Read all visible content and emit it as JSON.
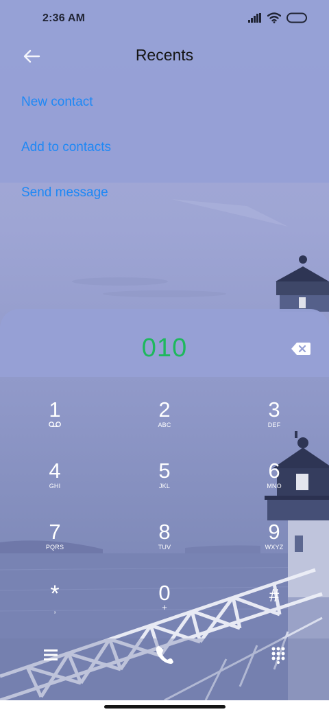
{
  "status_bar": {
    "time": "2:36 AM",
    "icons": [
      "signal-icon",
      "wifi-icon",
      "battery-icon"
    ]
  },
  "header": {
    "title": "Recents",
    "back_icon": "back-arrow-icon"
  },
  "actions": {
    "new_contact": "New contact",
    "add_to_contacts": "Add to contacts",
    "send_message": "Send message"
  },
  "dialer": {
    "number": "010",
    "backspace_icon": "backspace-icon",
    "keys": [
      {
        "digit": "1",
        "letters": "",
        "sub_icon": "voicemail-icon"
      },
      {
        "digit": "2",
        "letters": "ABC"
      },
      {
        "digit": "3",
        "letters": "DEF"
      },
      {
        "digit": "4",
        "letters": "GHI"
      },
      {
        "digit": "5",
        "letters": "JKL"
      },
      {
        "digit": "6",
        "letters": "MNO"
      },
      {
        "digit": "7",
        "letters": "PQRS"
      },
      {
        "digit": "8",
        "letters": "TUV"
      },
      {
        "digit": "9",
        "letters": "WXYZ"
      },
      {
        "digit": "*",
        "letters": ","
      },
      {
        "digit": "0",
        "letters": "+"
      },
      {
        "digit": "#",
        "letters": ""
      }
    ]
  },
  "bottom_bar": {
    "menu_icon": "menu-icon",
    "call_icon": "call-icon",
    "dialpad_icon": "dialpad-icon"
  },
  "colors": {
    "accent": "#1e88f5",
    "number": "#1eb85d"
  }
}
